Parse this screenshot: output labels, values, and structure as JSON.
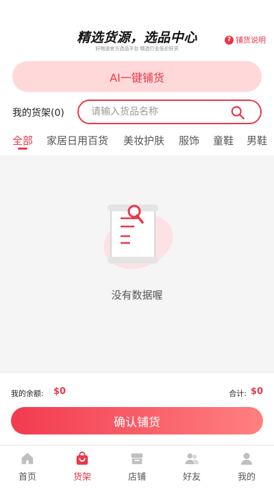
{
  "header": {
    "title": "精选货源，选品中心",
    "subtitle": "好物道官方选品平台 精选行业低价好货",
    "help_label": "铺货说明",
    "help_icon": "question-icon"
  },
  "ai_button": {
    "label": "AI一键铺货"
  },
  "shelf": {
    "label": "我的货架(0)",
    "search_placeholder": "请输入货品名称",
    "search_value": ""
  },
  "tabs": [
    {
      "label": "全部",
      "active": true
    },
    {
      "label": "家居日用百货"
    },
    {
      "label": "美妆护肤"
    },
    {
      "label": "服饰"
    },
    {
      "label": "童鞋"
    },
    {
      "label": "男鞋"
    }
  ],
  "empty": {
    "text": "没有数据喔",
    "icon": "empty-document-icon"
  },
  "summary": {
    "balance_label": "我的余额:",
    "balance_value": "$0",
    "total_label": "合计:",
    "total_value": "$0"
  },
  "confirm_button": {
    "label": "确认铺货"
  },
  "tabbar": [
    {
      "label": "首页",
      "icon": "home-icon"
    },
    {
      "label": "货架",
      "icon": "shopping-bag-icon",
      "active": true
    },
    {
      "label": "店铺",
      "icon": "store-icon"
    },
    {
      "label": "好友",
      "icon": "friends-icon"
    },
    {
      "label": "我的",
      "icon": "user-icon"
    }
  ],
  "colors": {
    "accent": "#e8374b",
    "accent_light": "#ffd9d9",
    "content_bg": "#f5f5f5"
  }
}
